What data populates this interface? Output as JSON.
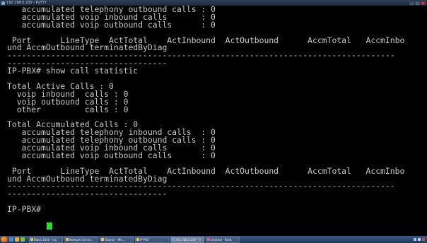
{
  "window": {
    "title": "192.168.0.200 - PuTTY",
    "controls": [
      "minimize",
      "maximize",
      "close"
    ]
  },
  "terminal": {
    "lines": [
      "   accumulated telephony outbound calls : 0",
      "   accumulated voip inbound calls       : 0",
      "   accumulated voip outbound calls      : 0",
      "",
      " Port      LineType  ActTotal    ActInbound  ActOutbound      AccmTotal   AccmInbo",
      "und AccmOutbound terminatedByDiag",
      "--------------------------------------------------------------------------------",
      "---------------------------------",
      "IP-PBX# show call statistic",
      "",
      "Total Active Calls : 0",
      "  voip inbound  calls : 0",
      "  voip outbound calls : 0",
      "  other         calls : 0",
      "",
      "Total Accumulated Calls : 0",
      "   accumulated telephony inbound calls  : 0",
      "   accumulated telephony outbound calls : 0",
      "   accumulated voip inbound calls       : 0",
      "   accumulated voip outbound calls      : 0",
      "",
      " Port      LineType  ActTotal    ActInbound  ActOutbound      AccmTotal   AccmInbo",
      "und AccmOutbound terminatedByDiag",
      "--------------------------------------------------------------------------------",
      "---------------------------------",
      "",
      "IP-PBX# "
    ],
    "cursor_color": "#2bdc2b"
  },
  "taskbar": {
    "tasks": [
      {
        "label": "Black 1000 - Inc",
        "active": false
      },
      {
        "label": "Network Conne...",
        "active": false
      },
      {
        "label": "Tutorial - Mic...",
        "active": false
      },
      {
        "label": "IP-PBX",
        "active": false
      },
      {
        "label": "192.168.0.200 - P",
        "active": true
      },
      {
        "label": "Untitled - Paint",
        "active": false
      }
    ]
  },
  "colors": {
    "terminal_bg": "#000000",
    "terminal_fg": "#c8c8c8",
    "taskbar": "#2a4a74"
  }
}
